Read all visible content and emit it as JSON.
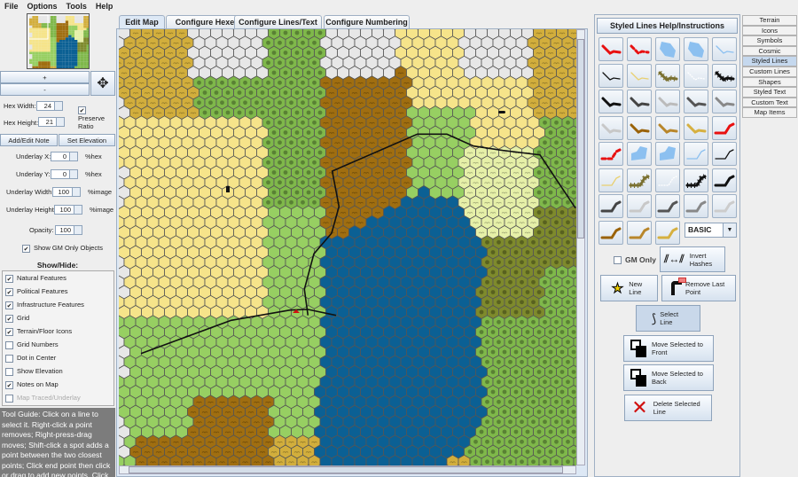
{
  "menu": [
    "File",
    "Options",
    "Tools",
    "Help"
  ],
  "left": {
    "zoom_in": "+",
    "zoom_out": "-",
    "pan_icon": "move-hand-icon",
    "hex_width_label": "Hex Width:",
    "hex_width": "24",
    "hex_height_label": "Hex Height:",
    "hex_height": "21",
    "preserve_ratio": "Preserve Ratio",
    "preserve_checked": true,
    "add_note": "Add/Edit Note",
    "set_elevation": "Set Elevation",
    "underlay_x_label": "Underlay X:",
    "underlay_x": "0",
    "underlay_x_unit": "%hex",
    "underlay_y_label": "Underlay Y:",
    "underlay_y": "0",
    "underlay_y_unit": "%hex",
    "underlay_w_label": "Underlay Width:",
    "underlay_w": "100",
    "underlay_w_unit": "%image",
    "underlay_h_label": "Underlay Height:",
    "underlay_h": "100",
    "underlay_h_unit": "%image",
    "opacity_label": "Opacity:",
    "opacity": "100",
    "show_gm": "Show GM Only Objects",
    "show_hide_title": "Show/Hide:",
    "show_hide": [
      {
        "label": "Natural Features",
        "checked": true
      },
      {
        "label": "Political Features",
        "checked": true
      },
      {
        "label": "Infrastructure Features",
        "checked": true
      },
      {
        "label": "Grid",
        "checked": true
      },
      {
        "label": "Terrain/Floor Icons",
        "checked": true
      },
      {
        "label": "Grid Numbers",
        "checked": false
      },
      {
        "label": "Dot in Center",
        "checked": false
      },
      {
        "label": "Show Elevation",
        "checked": false
      },
      {
        "label": "Notes on Map",
        "checked": true
      },
      {
        "label": "Map Traced/Underlay",
        "checked": false,
        "disabled": true
      }
    ],
    "tool_guide": "Tool Guide: Click on a line to select it. Right-click a point removes; Right-press-drag moves; Shift-click a spot adds a point between the two closest points; Click end point then click or drag to add new points. Click"
  },
  "tabs": [
    {
      "label": "Edit Map",
      "active": true
    },
    {
      "label": "Configure Hexes"
    },
    {
      "label": "Configure Lines/Text"
    },
    {
      "label": "Configure Numbering"
    }
  ],
  "terrain_colors": {
    "gold_hills": "#d2ae3c",
    "yellow": "#f6e48a",
    "grass": "#97cf62",
    "forest": "#7fb84a",
    "brown": "#a06e10",
    "water": "#0b6094",
    "gray": "#e7e7e7",
    "olive": "#7e8a2c",
    "pale": "#e6f0a8"
  },
  "right": {
    "help_button": "Styled Lines Help/Instructions",
    "swatches": [
      {
        "c": "#e81010",
        "s": "thick"
      },
      {
        "c": "#e81010",
        "s": "dashthick"
      },
      {
        "c": "#8cc0f0",
        "s": "area"
      },
      {
        "c": "#8cc0f0",
        "s": "areav"
      },
      {
        "c": "#8cc0f0",
        "s": "thin"
      },
      {
        "c": "#111",
        "s": "thin"
      },
      {
        "c": "#e9d070",
        "s": "thin"
      },
      {
        "c": "#7a7030",
        "s": "hatch"
      },
      {
        "c": "#fff",
        "s": "dotted"
      },
      {
        "c": "#111",
        "s": "chain"
      },
      {
        "c": "#111",
        "s": "thick"
      },
      {
        "c": "#444",
        "s": "thick"
      },
      {
        "c": "#bbb",
        "s": "thick"
      },
      {
        "c": "#555",
        "s": "thick"
      },
      {
        "c": "#888",
        "s": "thick"
      },
      {
        "c": "#c8c8c8",
        "s": "thick"
      },
      {
        "c": "#9a6208",
        "s": "thick"
      },
      {
        "c": "#b8862a",
        "s": "thick"
      },
      {
        "c": "#d6b040",
        "s": "thick"
      },
      {
        "c": "#e81010",
        "s": "thickup"
      },
      {
        "c": "#e81010",
        "s": "dashup"
      },
      {
        "c": "#8cc0f0",
        "s": "areaup"
      },
      {
        "c": "#8cc0f0",
        "s": "areaup2"
      },
      {
        "c": "#8cc0f0",
        "s": "thinup"
      },
      {
        "c": "#111",
        "s": "thinup"
      },
      {
        "c": "#e9d070",
        "s": "thinup"
      },
      {
        "c": "#7a7030",
        "s": "hatchup"
      },
      {
        "c": "#fff",
        "s": "dotup"
      },
      {
        "c": "#111",
        "s": "chainup"
      },
      {
        "c": "#111",
        "s": "thickup"
      },
      {
        "c": "#444",
        "s": "thickup"
      },
      {
        "c": "#c8c8c8",
        "s": "thickup"
      },
      {
        "c": "#555",
        "s": "thickup"
      },
      {
        "c": "#888",
        "s": "thickup"
      },
      {
        "c": "#ccc",
        "s": "thickup"
      },
      {
        "c": "#9a6208",
        "s": "thickup"
      },
      {
        "c": "#b8862a",
        "s": "thickup"
      },
      {
        "c": "#d6b040",
        "s": "thickup"
      }
    ],
    "style_select": "BASIC",
    "gm_only": "GM Only",
    "invert_hashes": "Invert Hashes",
    "new_line": "New Line",
    "remove_last": "Remove Last Point",
    "select_line": "Select Line",
    "move_front": "Move Selected to Front",
    "move_back": "Move Selected to Back",
    "delete_line": "Delete Selected Line"
  },
  "side_tabs": [
    {
      "label": "Terrain"
    },
    {
      "label": "Icons"
    },
    {
      "label": "Symbols"
    },
    {
      "label": "Cosmic"
    },
    {
      "label": "Styled Lines",
      "active": true
    },
    {
      "label": "Custom Lines"
    },
    {
      "label": "Shapes"
    },
    {
      "label": "Styled Text"
    },
    {
      "label": "Custom Text"
    },
    {
      "label": "Map Items"
    }
  ]
}
